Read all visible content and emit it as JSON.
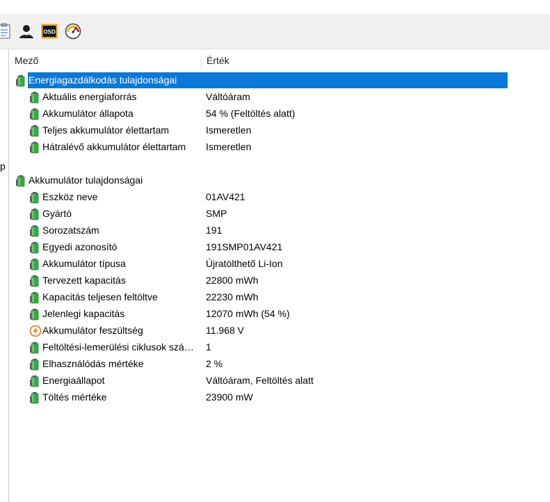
{
  "toolbar": {
    "icons": [
      "report-icon",
      "user-icon",
      "osd-icon",
      "gauge-icon"
    ],
    "osd_label": "OSD"
  },
  "left_pane": {
    "cut_text": "p"
  },
  "columns": {
    "field": "Mező",
    "value": "Érték"
  },
  "colors": {
    "selection": "#0a78d7",
    "battery_green": "#3ba845"
  },
  "sections": [
    {
      "title": "Energiagazdálkodás tulajdonságai",
      "selected": true,
      "rows": [
        {
          "field": "Aktuális energiaforrás",
          "value": "Váltóáram",
          "icon": "battery-icon"
        },
        {
          "field": "Akkumulátor állapota",
          "value": "54 % (Feltöltés alatt)",
          "icon": "battery-icon"
        },
        {
          "field": "Teljes akkumulátor élettartam",
          "value": "Ismeretlen",
          "icon": "battery-icon"
        },
        {
          "field": "Hátralévő akkumulátor élettartam",
          "value": "Ismeretlen",
          "icon": "battery-icon"
        }
      ]
    },
    {
      "title": "Akkumulátor tulajdonságai",
      "selected": false,
      "rows": [
        {
          "field": "Eszköz neve",
          "value": "01AV421",
          "icon": "battery-icon"
        },
        {
          "field": "Gyártó",
          "value": "SMP",
          "icon": "battery-icon"
        },
        {
          "field": "Sorozatszám",
          "value": "191",
          "icon": "battery-icon"
        },
        {
          "field": "Egyedi azonosító",
          "value": "191SMP01AV421",
          "icon": "battery-icon"
        },
        {
          "field": "Akkumulátor típusa",
          "value": "Újratölthető Li-Ion",
          "icon": "battery-icon"
        },
        {
          "field": "Tervezett kapacitás",
          "value": "22800 mWh",
          "icon": "battery-icon"
        },
        {
          "field": "Kapacitás teljesen feltöltve",
          "value": "22230 mWh",
          "icon": "battery-icon"
        },
        {
          "field": "Jelenlegi kapacitás",
          "value": "12070 mWh  (54 %)",
          "icon": "battery-icon"
        },
        {
          "field": "Akkumulátor feszültség",
          "value": "11.968 V",
          "icon": "voltage-icon"
        },
        {
          "field": "Feltöltési-lemerülési ciklusok szá…",
          "value": "1",
          "icon": "battery-icon"
        },
        {
          "field": "Elhasználódás mértéke",
          "value": "2 %",
          "icon": "battery-icon"
        },
        {
          "field": "Energiaállapot",
          "value": "Váltóáram, Feltöltés alatt",
          "icon": "battery-icon"
        },
        {
          "field": "Töltés mértéke",
          "value": "23900 mW",
          "icon": "battery-icon"
        }
      ]
    }
  ]
}
